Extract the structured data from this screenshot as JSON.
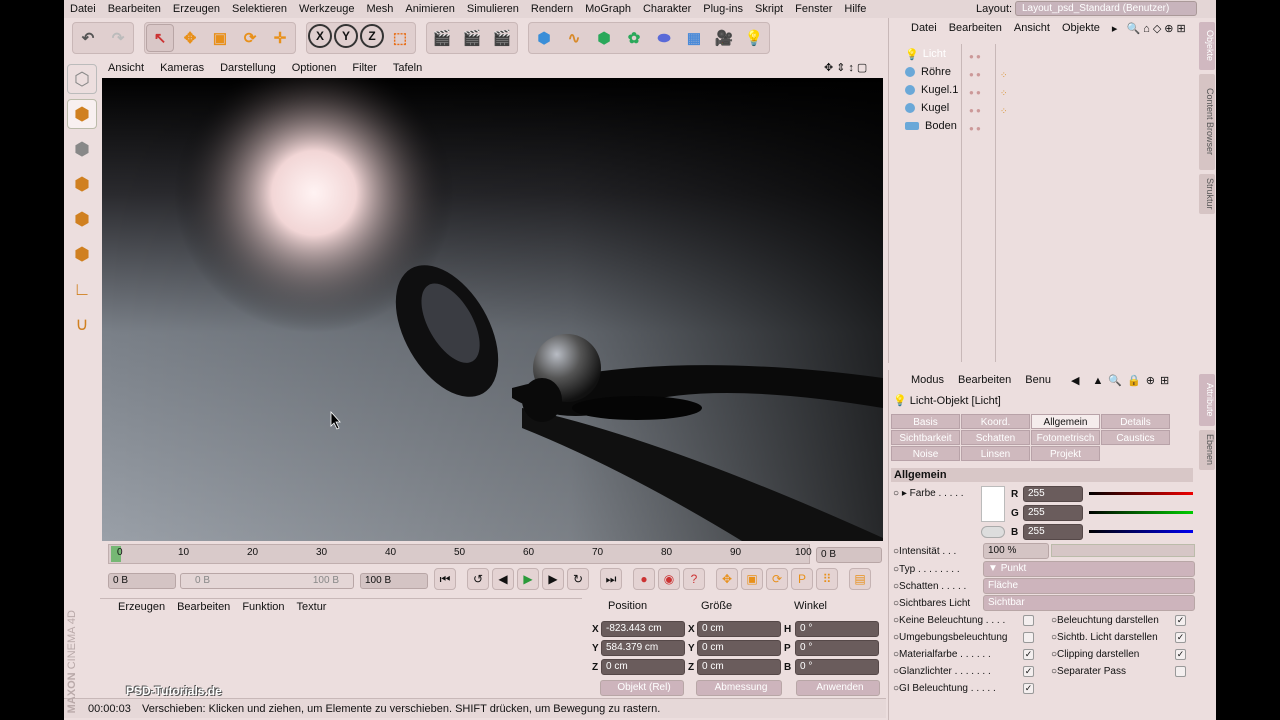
{
  "menu": [
    "Datei",
    "Bearbeiten",
    "Erzeugen",
    "Selektieren",
    "Werkzeuge",
    "Mesh",
    "Animieren",
    "Simulieren",
    "Rendern",
    "MoGraph",
    "Charakter",
    "Plug-ins",
    "Skript",
    "Fenster",
    "Hilfe"
  ],
  "layout": {
    "label": "Layout:",
    "value": "Layout_psd_Standard (Benutzer)"
  },
  "toolbar": {
    "x": "X",
    "y": "Y",
    "z": "Z"
  },
  "viewport_menu": [
    "Ansicht",
    "Kameras",
    "Darstellung",
    "Optionen",
    "Filter",
    "Tafeln"
  ],
  "timeline": {
    "ticks": [
      "0",
      "10",
      "20",
      "30",
      "40",
      "50",
      "60",
      "70",
      "80",
      "90",
      "100"
    ],
    "current": "0 B"
  },
  "frames": {
    "start": "0 B",
    "range_start": "0 B",
    "range_end": "100 B",
    "end": "100 B"
  },
  "material_menu": [
    "Erzeugen",
    "Bearbeiten",
    "Funktion",
    "Textur"
  ],
  "coords": {
    "headers": [
      "Position",
      "Größe",
      "Winkel"
    ],
    "rows": [
      {
        "axis": "X",
        "pos": "-823.443 cm",
        "size_axis": "X",
        "size": "0 cm",
        "rot_axis": "H",
        "rot": "0 °"
      },
      {
        "axis": "Y",
        "pos": "584.379 cm",
        "size_axis": "Y",
        "size": "0 cm",
        "rot_axis": "P",
        "rot": "0 °"
      },
      {
        "axis": "Z",
        "pos": "0 cm",
        "size_axis": "Z",
        "size": "0 cm",
        "rot_axis": "B",
        "rot": "0 °"
      }
    ],
    "mode1": "Objekt (Rel)",
    "mode2": "Abmessung",
    "apply": "Anwenden"
  },
  "status": {
    "time": "00:00:03",
    "message": "Verschieben: Klicken und ziehen, um Elemente zu verschieben. SHIFT drücken, um Bewegung zu rastern."
  },
  "objects_menu": [
    "Datei",
    "Bearbeiten",
    "Ansicht",
    "Objekte"
  ],
  "objects": [
    "Licht",
    "Röhre",
    "Kugel.1",
    "Kugel",
    "Boden"
  ],
  "attr_menu": [
    "Modus",
    "Bearbeiten",
    "Benu"
  ],
  "attr_title": "Licht-Objekt [Licht]",
  "tabs": {
    "row1": [
      "Basis",
      "Koord.",
      "Allgemein",
      "Details"
    ],
    "row2": [
      "Sichtbarkeit",
      "Schatten",
      "Fotometrisch",
      "Caustics"
    ],
    "row3": [
      "Noise",
      "Linsen",
      "Projekt"
    ]
  },
  "section": "Allgemein",
  "props": {
    "farbe": "Farbe",
    "r": "R",
    "g": "G",
    "b": "B",
    "rv": "255",
    "gv": "255",
    "bv": "255",
    "intensitaet": "Intensität",
    "intensitaet_v": "100 %",
    "typ": "Typ",
    "typ_v": "Punkt",
    "schatten": "Schatten",
    "schatten_v": "Fläche",
    "sichtbar": "Sichtbares Licht",
    "sichtbar_v": "Sichtbar",
    "checks_left": [
      "Keine Beleuchtung",
      "Umgebungsbeleuchtung",
      "Materialfarbe",
      "Glanzlichter",
      "GI Beleuchtung"
    ],
    "checks_right": [
      "Beleuchtung darstellen",
      "Sichtb. Licht darstellen",
      "Clipping darstellen",
      "Separater Pass"
    ]
  },
  "side_tabs": [
    "Objekte",
    "Content Browser",
    "Struktur",
    "Attribute",
    "Ebenen"
  ],
  "watermark": {
    "maxon": "MAXON",
    "c4d": "CINEMA 4D",
    "site": "PSD-Tutorials.de"
  },
  "colors": {
    "accent": "#d0b8c0",
    "panel": "#ecdede",
    "timeline_marker": "#4caf50"
  }
}
